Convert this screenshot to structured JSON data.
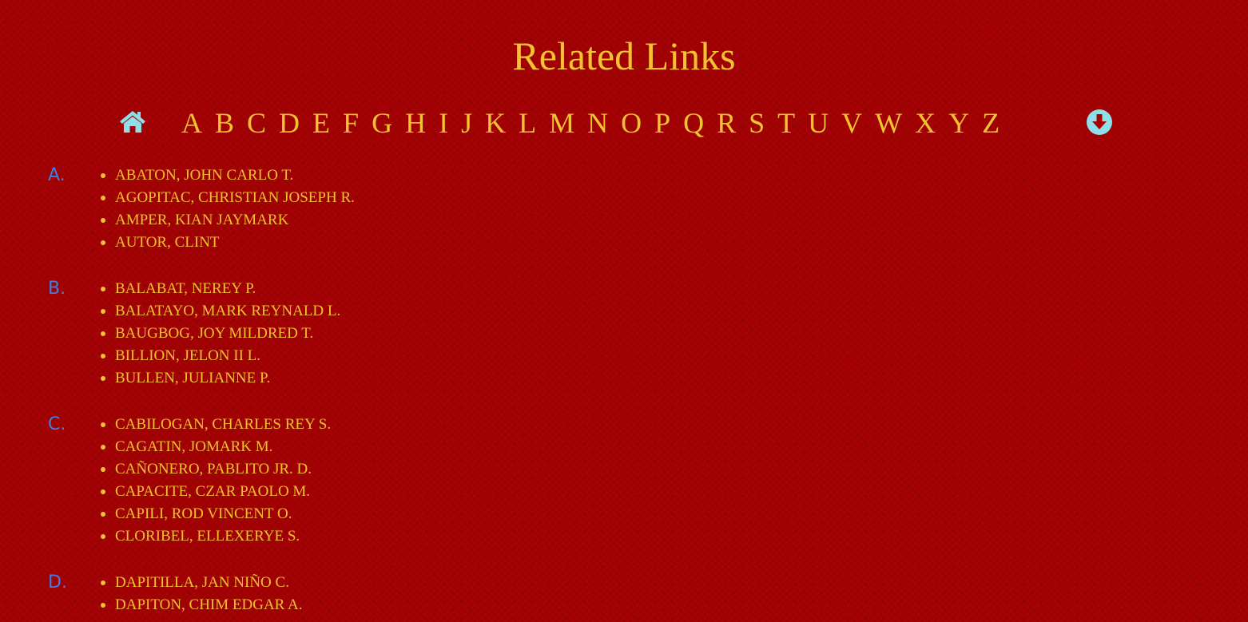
{
  "page": {
    "title": "Related Links"
  },
  "nav": {
    "home_icon": "home-icon",
    "down_icon": "arrow-circle-down-icon",
    "letters": [
      "A",
      "B",
      "C",
      "D",
      "E",
      "F",
      "G",
      "H",
      "I",
      "J",
      "K",
      "L",
      "M",
      "N",
      "O",
      "P",
      "Q",
      "R",
      "S",
      "T",
      "U",
      "V",
      "W",
      "X",
      "Y",
      "Z"
    ]
  },
  "groups": [
    {
      "letter": "A.",
      "names": [
        "ABATON, JOHN CARLO T.",
        "AGOPITAC, CHRISTIAN JOSEPH R.",
        "AMPER, KIAN JAYMARK",
        "AUTOR, CLINT"
      ]
    },
    {
      "letter": "B.",
      "names": [
        "BALABAT, NEREY P.",
        "BALATAYO, MARK REYNALD L.",
        "BAUGBOG, JOY MILDRED T.",
        "BILLION, JELON II L.",
        "BULLEN, JULIANNE P."
      ]
    },
    {
      "letter": "C.",
      "names": [
        "CABILOGAN, CHARLES REY S.",
        "CAGATIN, JOMARK M.",
        "CAÑONERO, PABLITO JR. D.",
        "CAPACITE, CZAR PAOLO M.",
        "CAPILI, ROD VINCENT O.",
        "CLORIBEL, ELLEXERYE S."
      ]
    },
    {
      "letter": "D.",
      "names": [
        "DAPITILLA, JAN NIÑO C.",
        "DAPITON, CHIM EDGAR A."
      ]
    }
  ],
  "colors": {
    "background": "#a60204",
    "text": "#f2c230",
    "group_letter": "#3f7fe0",
    "icon": "#8ee0e8"
  }
}
